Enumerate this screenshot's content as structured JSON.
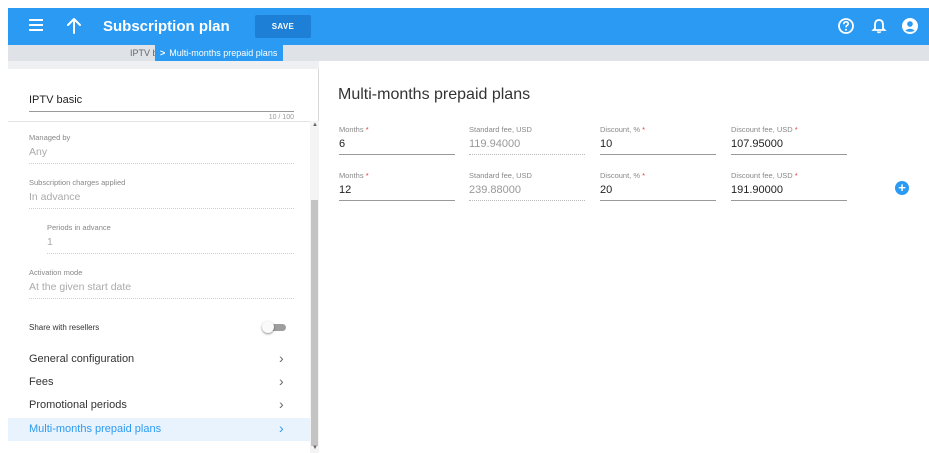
{
  "header": {
    "title": "Subscription plan",
    "save_label": "SAVE",
    "icons": [
      "menu-icon",
      "arrow-up-icon",
      "help-icon",
      "bell-icon",
      "account-icon"
    ]
  },
  "breadcrumb": {
    "items": [
      "IPTV basic",
      "Multi-months prepaid plans"
    ]
  },
  "left": {
    "name_value": "IPTV basic",
    "name_counter": "10 / 100",
    "managed_by": {
      "label": "Managed by",
      "value": "Any"
    },
    "charges": {
      "label": "Subscription charges applied",
      "value": "In advance"
    },
    "periods": {
      "label": "Periods in advance",
      "value": "1"
    },
    "activation": {
      "label": "Activation mode",
      "value": "At the given start date"
    },
    "share_label": "Share with resellers",
    "share_enabled": false,
    "nav": [
      {
        "label": "General configuration",
        "active": false
      },
      {
        "label": "Fees",
        "active": false
      },
      {
        "label": "Promotional periods",
        "active": false
      },
      {
        "label": "Multi-months prepaid plans",
        "active": true
      }
    ]
  },
  "main": {
    "title": "Multi-months prepaid plans",
    "columns": {
      "months": "Months",
      "standard_fee": "Standard fee, USD",
      "discount": "Discount, %",
      "discount_fee": "Discount fee, USD"
    },
    "required_mark": "*",
    "rows": [
      {
        "months": "6",
        "standard_fee": "119.94000",
        "discount": "10",
        "discount_fee": "107.95000"
      },
      {
        "months": "12",
        "standard_fee": "239.88000",
        "discount": "20",
        "discount_fee": "191.90000"
      }
    ],
    "add_label": "+"
  },
  "colors": {
    "accent": "#2b9af3",
    "save_button": "#1e7fd6",
    "required": "#e53935",
    "active_nav_bg": "#e9f3fd"
  }
}
